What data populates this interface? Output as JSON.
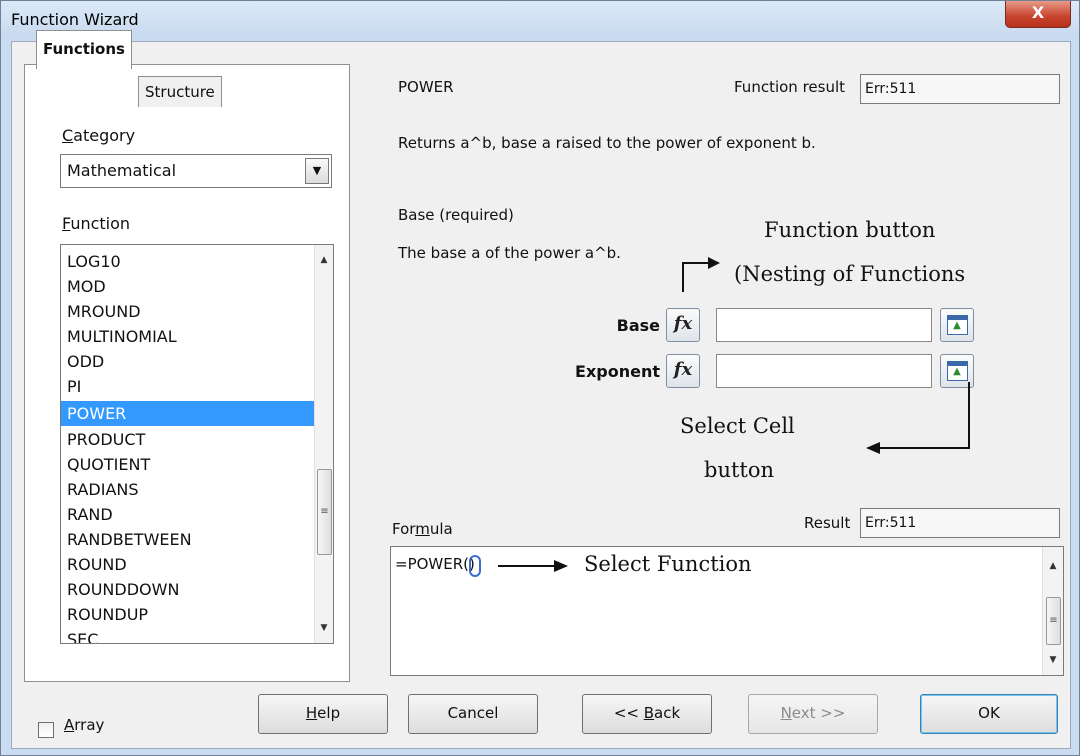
{
  "window": {
    "title": "Function Wizard",
    "close_glyph": "X"
  },
  "tabs": [
    {
      "label": "Functions",
      "active": true
    },
    {
      "label": "Structure",
      "active": false
    }
  ],
  "category": {
    "label": "Category",
    "value": "Mathematical"
  },
  "function_list": {
    "label": "Function",
    "items": [
      "LOG10",
      "MOD",
      "MROUND",
      "MULTINOMIAL",
      "ODD",
      "PI",
      "POWER",
      "PRODUCT",
      "QUOTIENT",
      "RADIANS",
      "RAND",
      "RANDBETWEEN",
      "ROUND",
      "ROUNDDOWN",
      "ROUNDUP",
      "SEC"
    ],
    "selected": "POWER"
  },
  "detail": {
    "function_name": "POWER",
    "function_result_label": "Function result",
    "function_result_value": "Err:511",
    "description": "Returns a^b, base a raised to the power of exponent b.",
    "arg_heading": "Base (required)",
    "arg_description": "The base a of the power a^b."
  },
  "arguments": [
    {
      "label": "Base",
      "value": ""
    },
    {
      "label": "Exponent",
      "value": ""
    }
  ],
  "fx_glyph": "fx",
  "formula": {
    "label": "Formula",
    "text": "=POWER()",
    "result_label": "Result",
    "result_value": "Err:511"
  },
  "array_checkbox": {
    "label": "Array",
    "checked": false
  },
  "buttons": {
    "help": "Help",
    "cancel": "Cancel",
    "back": "<< Back",
    "next": "Next >>",
    "ok": "OK"
  },
  "annotations": {
    "function_button_line1": "Function button",
    "function_button_line2": "(Nesting of Functions",
    "select_cell_line1": "Select Cell",
    "select_cell_line2": "button",
    "select_function": "Select Function"
  }
}
